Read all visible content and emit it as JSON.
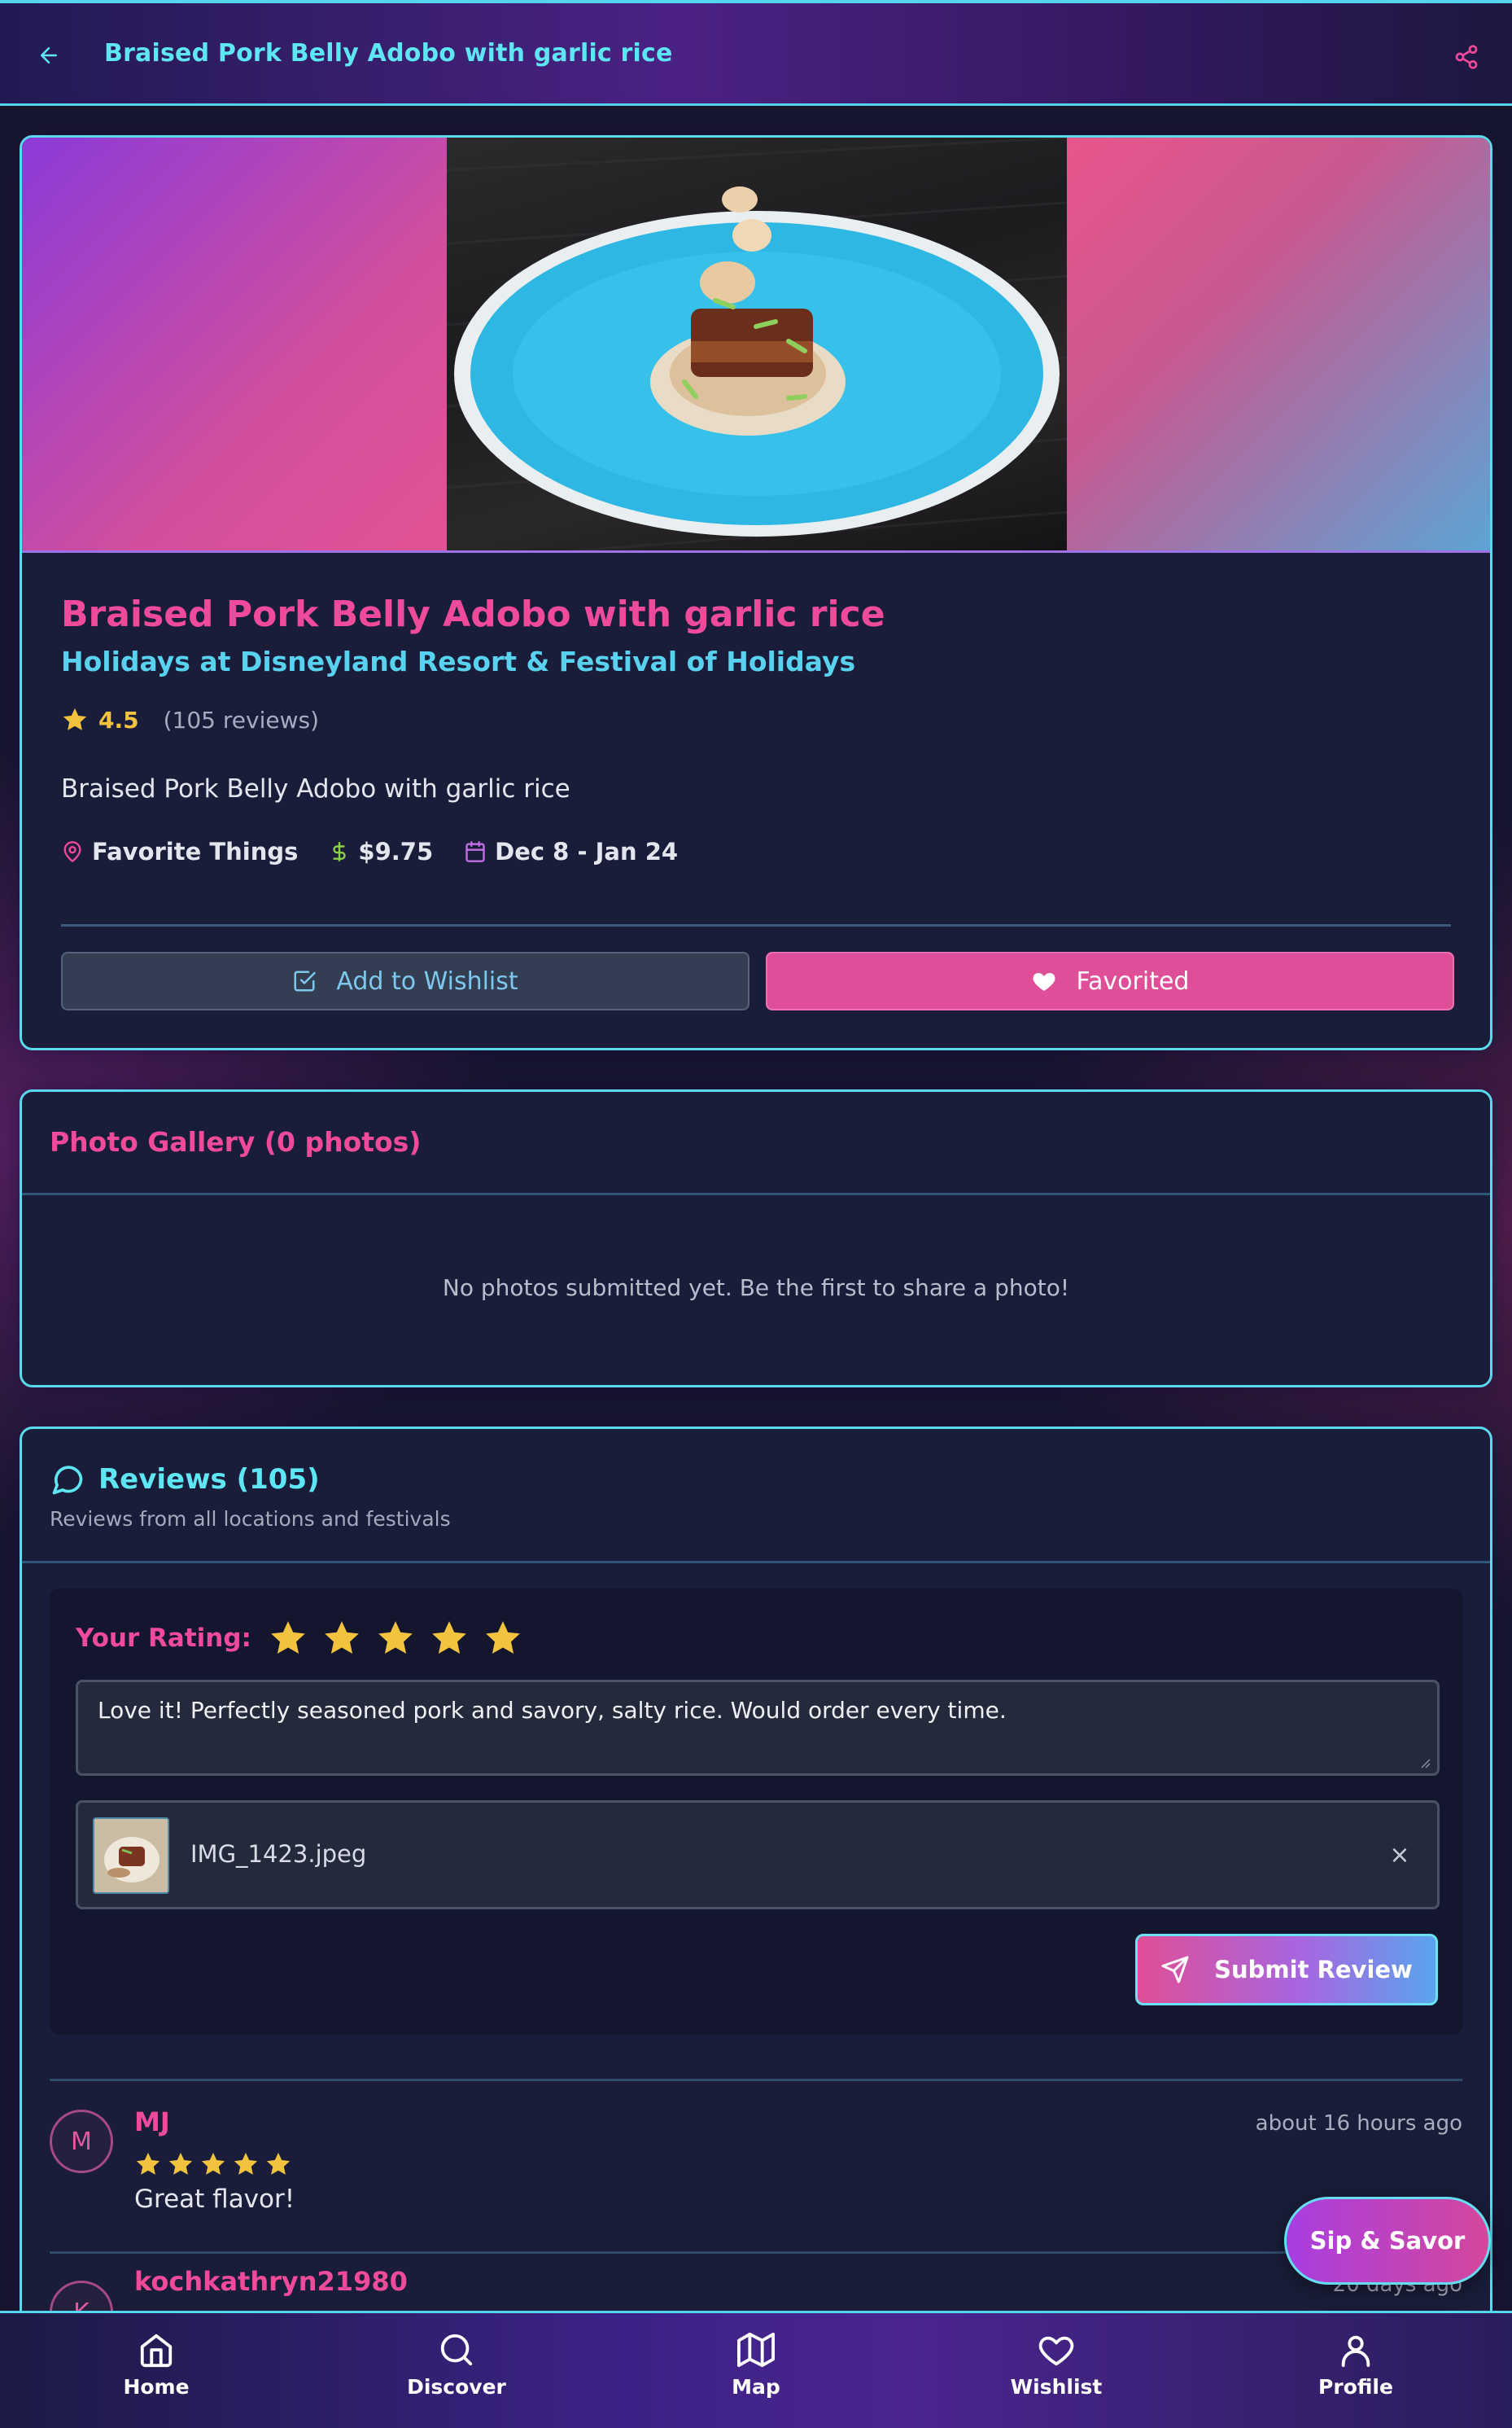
{
  "header": {
    "title": "Braised Pork Belly Adobo with garlic rice"
  },
  "item": {
    "title": "Braised Pork Belly Adobo with garlic rice",
    "festival": "Holidays at Disneyland Resort & Festival of Holidays",
    "rating": "4.5",
    "review_count": "(105 reviews)",
    "description": "Braised Pork Belly Adobo with garlic rice",
    "location": "Favorite Things",
    "price": "$9.75",
    "dates": "Dec 8 - Jan 24",
    "wishlist_label": "Add to Wishlist",
    "favorite_label": "Favorited"
  },
  "gallery": {
    "title": "Photo Gallery (0 photos)",
    "empty_text": "No photos submitted yet. Be the first to share a photo!"
  },
  "reviews": {
    "title": "Reviews (105)",
    "subtitle": "Reviews from all locations and festivals",
    "compose": {
      "rating_label": "Your Rating:",
      "rating": 5,
      "text": "Love it! Perfectly seasoned pork and savory, salty rice. Would order every time.",
      "attachment_name": "IMG_1423.jpeg",
      "remove_label": "×",
      "submit_label": "Submit Review"
    },
    "items": [
      {
        "initial": "M",
        "author": "MJ",
        "time": "about 16 hours ago",
        "stars": 5,
        "text": "Great flavor!"
      },
      {
        "initial": "K",
        "author": "kochkathryn21980",
        "time": "20 days ago"
      }
    ]
  },
  "floating": {
    "label": "Sip & Savor"
  },
  "nav": {
    "items": [
      {
        "label": "Home",
        "icon": "home-icon"
      },
      {
        "label": "Discover",
        "icon": "search-icon"
      },
      {
        "label": "Map",
        "icon": "map-icon"
      },
      {
        "label": "Wishlist",
        "icon": "heart-icon"
      },
      {
        "label": "Profile",
        "icon": "user-icon"
      }
    ]
  },
  "colors": {
    "accent_pink": "#ef4b9a",
    "accent_cyan": "#5ee6f4",
    "star": "#f3c23f",
    "card_bg": "#1a1d39"
  }
}
